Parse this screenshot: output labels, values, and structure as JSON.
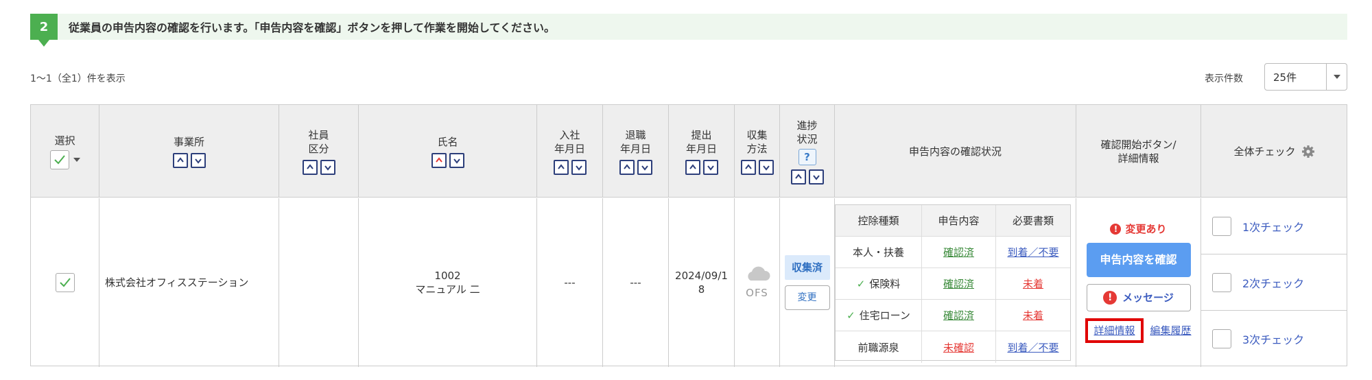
{
  "banner": {
    "step": "2",
    "text": "従業員の申告内容の確認を行います。「申告内容を確認」ボタンを押して作業を開始してください。"
  },
  "toolbar": {
    "count_text": "1～1（全1）件を表示",
    "per_page_label": "表示件数",
    "per_page_value": "25件"
  },
  "headers": {
    "select": "選択",
    "office": "事業所",
    "emp_type_1": "社員",
    "emp_type_2": "区分",
    "name": "氏名",
    "join_1": "入社",
    "join_2": "年月日",
    "leave_1": "退職",
    "leave_2": "年月日",
    "submit_1": "提出",
    "submit_2": "年月日",
    "collect_1": "収集",
    "collect_2": "方法",
    "progress_1": "進捗",
    "progress_2": "状況",
    "help": "?",
    "status": "申告内容の確認状況",
    "start_1": "確認開始ボタン/",
    "start_2": "詳細情報",
    "all_check": "全体チェック"
  },
  "row": {
    "office": "株式会社オフィスステーション",
    "emp_no": "1002",
    "name": "マニュアル 二",
    "join_date": "---",
    "leave_date": "---",
    "submit_date_1": "2024/09/1",
    "submit_date_2": "8",
    "collect_method": "OFS",
    "progress": "収集済",
    "change_button": "変更",
    "changed_label": "変更あり",
    "confirm_button": "申告内容を確認",
    "message_button": "メッセージ",
    "detail_link": "詳細情報",
    "history_link": "編集履歴"
  },
  "inner_table": {
    "headers": [
      "控除種類",
      "申告内容",
      "必要書類"
    ],
    "rows": [
      {
        "type": "本人・扶養",
        "checked": false,
        "content": "確認済",
        "content_status": "ok",
        "docs": "到着／不要",
        "docs_status": "ok"
      },
      {
        "type": "保険料",
        "checked": true,
        "content": "確認済",
        "content_status": "ok",
        "docs": "未着",
        "docs_status": "ng"
      },
      {
        "type": "住宅ローン",
        "checked": true,
        "content": "確認済",
        "content_status": "ok",
        "docs": "未着",
        "docs_status": "ng"
      },
      {
        "type": "前職源泉",
        "checked": false,
        "content": "未確認",
        "content_status": "ng",
        "docs": "到着／不要",
        "docs_status": "ok"
      }
    ]
  },
  "checks": [
    "1次チェック",
    "2次チェック",
    "3次チェック"
  ],
  "colors": {
    "accent_green": "#4caf50",
    "primary_blue": "#5b9df1",
    "alert_red": "#e53935",
    "highlight_red": "#e00000"
  }
}
